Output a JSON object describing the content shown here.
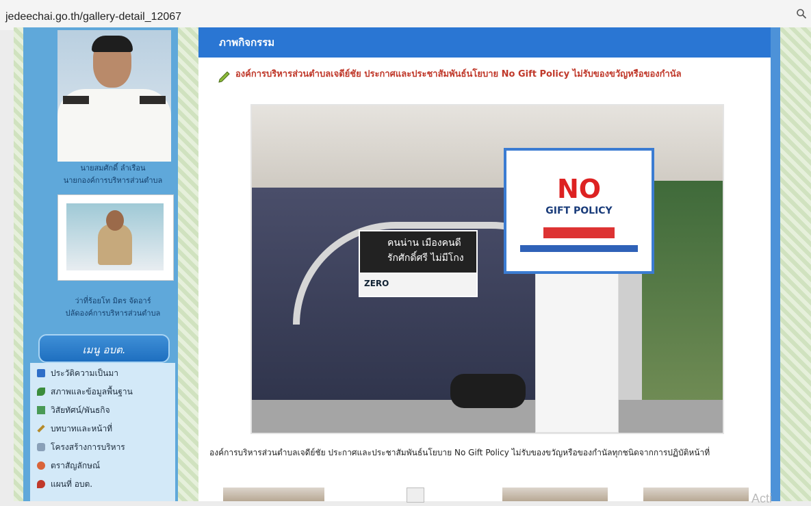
{
  "browser": {
    "url": "jedeechai.go.th/gallery-detail_12067"
  },
  "sidebar": {
    "person1": {
      "name": "นายสมศักดิ์ ลำเรือน",
      "position": "นายกองค์การบริหารส่วนตำบล"
    },
    "person2": {
      "name": "ว่าที่ร้อยโท มิตร จัดอาร์",
      "position": "ปลัดองค์การบริหารส่วนตำบล"
    },
    "menu_title": "เมนู อบต.",
    "menu_items": [
      {
        "label": "ประวัติความเป็นมา",
        "icon": "book-icon"
      },
      {
        "label": "สภาพและข้อมูลพื้นฐาน",
        "icon": "map-icon"
      },
      {
        "label": "วิสัยทัศน์/พันธกิจ",
        "icon": "flag-icon"
      },
      {
        "label": "บทบาทและหน้าที่",
        "icon": "pen-icon"
      },
      {
        "label": "โครงสร้างการบริหาร",
        "icon": "org-icon"
      },
      {
        "label": "ตราสัญลักษณ์",
        "icon": "emblem-icon"
      },
      {
        "label": "แผนที่ อบต.",
        "icon": "pin-icon"
      }
    ]
  },
  "main": {
    "section_title": "ภาพกิจกรรม",
    "article_title": "องค์การบริหารส่วนตำบลเจดีย์ชัย ประกาศและประชาสัมพันธ์นโยบาย No Gift Policy ไม่รับของขวัญหรือของกำนัล",
    "photo": {
      "sign1_line1": "คนน่าน เมืองคนดี",
      "sign1_line2": "รักศักดิ์ศรี ไม่มีโกง",
      "sign1_logo": "ZERO",
      "sign2_big": "NO",
      "sign2_sub": "GIFT POLICY"
    },
    "caption": "องค์การบริหารส่วนตำบลเจดีย์ชัย ประกาศและประชาสัมพันธ์นโยบาย No Gift Policy ไม่รับของขวัญหรือของกำนัลทุกชนิดจากการปฏิบัติหน้าที่"
  },
  "overlay": {
    "watermark": "Acti"
  }
}
